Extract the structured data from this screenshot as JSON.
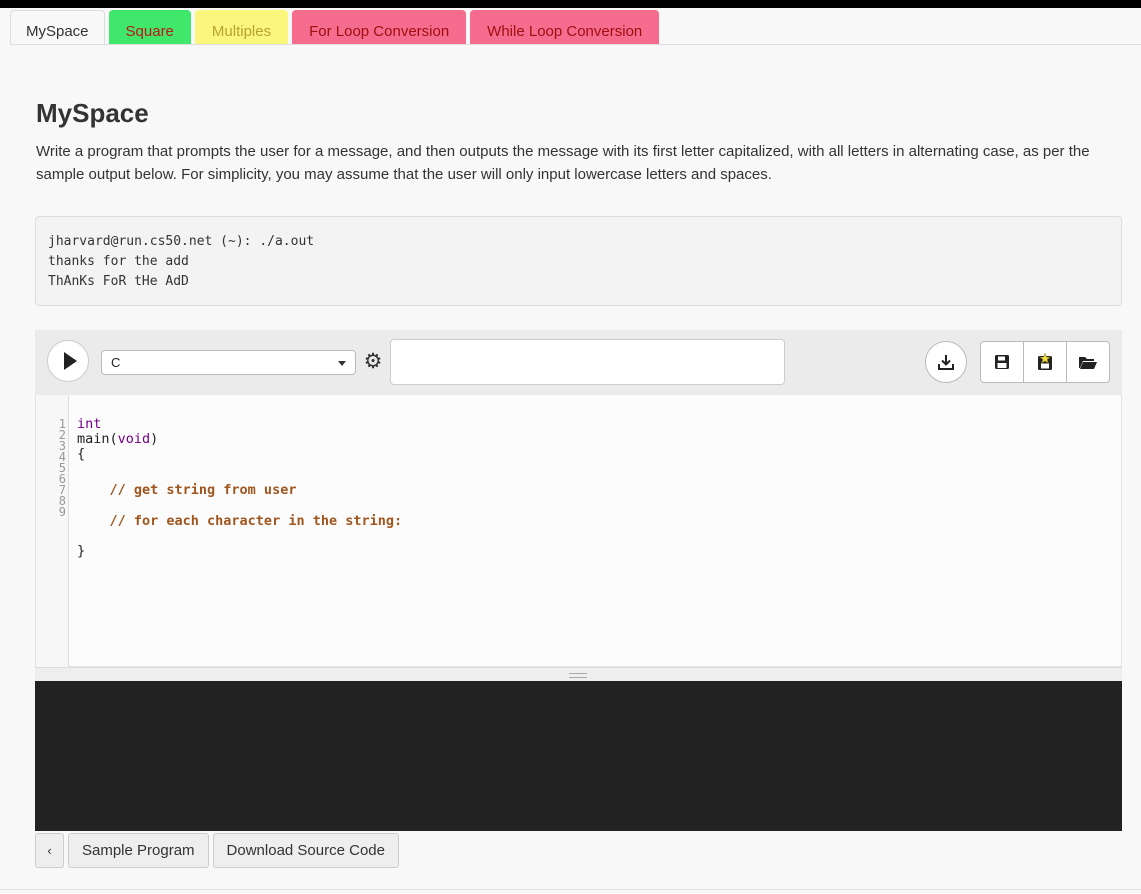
{
  "tabs": [
    {
      "label": "MySpace",
      "active": true
    },
    {
      "label": "Square"
    },
    {
      "label": "Multiples"
    },
    {
      "label": "For Loop Conversion"
    },
    {
      "label": "While Loop Conversion"
    }
  ],
  "page": {
    "title": "MySpace",
    "description": "Write a program that prompts the user for a message, and then outputs the message with its first letter capitalized, with all letters in alternating case, as per the sample output below. For simplicity, you may assume that the user will only input lowercase letters and spaces."
  },
  "sample_output": {
    "lines": [
      "jharvard@run.cs50.net (~): ./a.out",
      "thanks for the add",
      "ThAnKs FoR tHe AdD"
    ]
  },
  "toolbar": {
    "run_icon": "play-icon",
    "language": "C",
    "settings_icon": "gear-icon",
    "args_value": "",
    "download_icon": "download-icon",
    "save_icon": "floppy-disk-icon",
    "save_as_icon": "floppy-disk-star-icon",
    "open_icon": "folder-open-icon"
  },
  "editor": {
    "line_numbers": [
      "1",
      "2",
      "3",
      "4",
      "5",
      "6",
      "7",
      "8",
      "9"
    ],
    "code": {
      "l1": "int",
      "l2_fn": "main(",
      "l2_kw": "void",
      "l2_end": ")",
      "l3": "{",
      "l5": "    // get string from user",
      "l7": "    // for each character in the string:",
      "l9": "}"
    }
  },
  "bottom_bar": {
    "collapse_label": "‹",
    "sample_program_label": "Sample Program",
    "download_source_label": "Download Source Code"
  },
  "colors": {
    "square_tab": "#3fe86a",
    "multiples_tab": "#fbf67c",
    "loop_tabs": "#f56c8e",
    "terminal_bg": "#222222"
  }
}
